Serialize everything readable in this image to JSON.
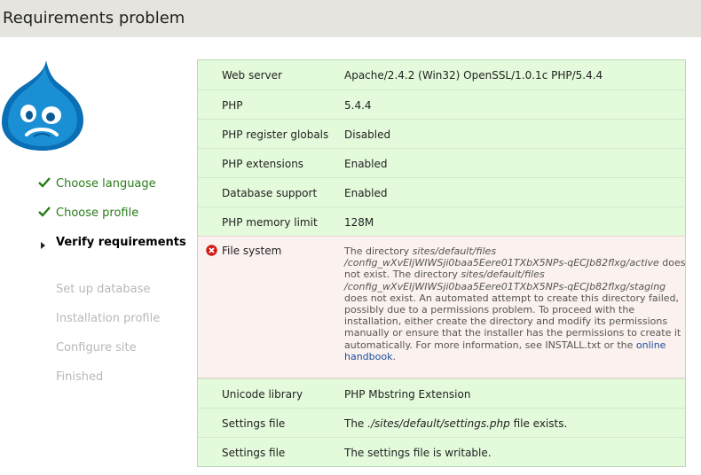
{
  "header": {
    "title": "Requirements problem"
  },
  "colors": {
    "done": "#2a7b1a",
    "todo": "#b8b8b8",
    "ok_row": "#e3fadb",
    "error_row": "#fbf1ef",
    "logo": "#0677c1"
  },
  "steps": [
    {
      "label": "Choose language",
      "state": "done",
      "icon": "check-icon"
    },
    {
      "label": "Choose profile",
      "state": "done",
      "icon": "check-icon"
    },
    {
      "label": "Verify requirements",
      "state": "active",
      "icon": "arrow-icon"
    },
    {
      "label": "Set up database",
      "state": "todo"
    },
    {
      "label": "Installation profile",
      "state": "todo"
    },
    {
      "label": "Configure site",
      "state": "todo"
    },
    {
      "label": "Finished",
      "state": "todo"
    }
  ],
  "requirements": {
    "web_server": {
      "label": "Web server",
      "value": "Apache/2.4.2 (Win32) OpenSSL/1.0.1c PHP/5.4.4"
    },
    "php": {
      "label": "PHP",
      "value": "5.4.4"
    },
    "register_globals": {
      "label": "PHP register globals",
      "value": "Disabled"
    },
    "extensions": {
      "label": "PHP extensions",
      "value": "Enabled"
    },
    "database": {
      "label": "Database support",
      "value": "Enabled"
    },
    "memory": {
      "label": "PHP memory limit",
      "value": "128M"
    },
    "file_system": {
      "label": "File system",
      "icon": "error-icon",
      "t1": "The directory ",
      "p1": "sites/default/files /config_wXvEIjWIWSji0baa5Eere01TXbX5NPs-qECJb82flxg/active",
      "t2": " does not exist. The directory ",
      "p2": "sites/default/files /config_wXvEIjWIWSji0baa5Eere01TXbX5NPs-qECJb82flxg/staging",
      "t3": " does not exist. An automated attempt to create this directory failed, possibly due to a permissions problem. To proceed with the installation, either create the directory and modify its permissions manually or ensure that the installer has the permissions to create it automatically. For more information, see INSTALL.txt or the ",
      "link": "online handbook",
      "t4": "."
    },
    "unicode": {
      "label": "Unicode library",
      "value": "PHP Mbstring Extension"
    },
    "settings_exists": {
      "label": "Settings file",
      "pre": "The ",
      "path": "./sites/default/settings.php",
      "post": " file exists."
    },
    "settings_writable": {
      "label": "Settings file",
      "value": "The settings file is writable."
    }
  }
}
